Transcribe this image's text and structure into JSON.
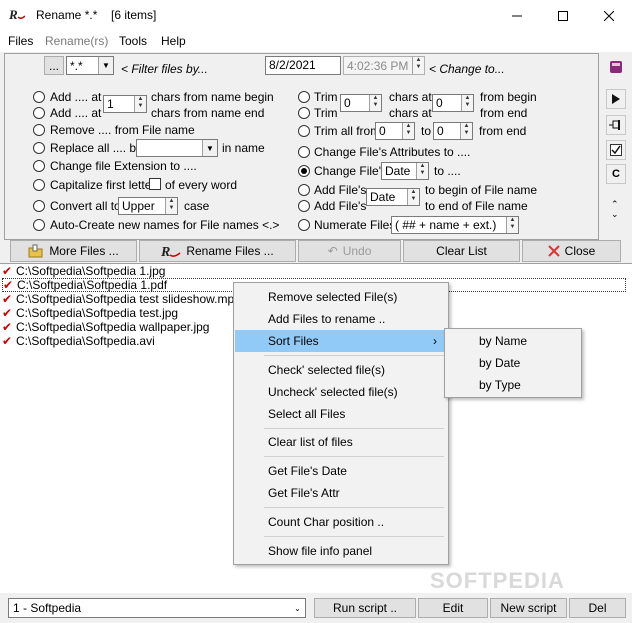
{
  "window": {
    "title": "Rename  *.*",
    "items": "[6 items]"
  },
  "menubar": [
    "Files",
    "Rename(rs)",
    "Tools",
    "Help"
  ],
  "filter": {
    "browse_label": "...",
    "mask": "*.*",
    "filter_label": "< Filter files by...",
    "date": "8/2/2021",
    "time": "4:02:36 PM",
    "change_label": "< Change  to..."
  },
  "options_left": {
    "add_at_1": "Add .... at",
    "add_at_1_value": "1",
    "add_at_1_suffix": "chars from name begin",
    "add_at_2": "Add .... at",
    "add_at_2_suffix": "chars from name end",
    "remove": "Remove  ....  from File name",
    "replace": "Replace all .... by",
    "replace_suffix": "in name",
    "change_ext": "Change file Extension to ....",
    "capitalize": "Capitalize first letter",
    "every_word": "of every word",
    "convert": "Convert all to",
    "convert_value": "Upper",
    "convert_suffix": "case",
    "auto_create": "Auto-Create new names for File names <.>"
  },
  "options_right": {
    "trim1": "Trim",
    "trim1_value": "0",
    "trim1_mid": "chars at",
    "trim1_value2": "0",
    "trim1_suffix": "from begin",
    "trim2": "Trim",
    "trim2_mid": "chars at",
    "trim2_suffix": "from  end",
    "trim_all": "Trim all from",
    "trim_all_value": "0",
    "trim_all_to": "to",
    "trim_all_value2": "0",
    "trim_all_suffix": "from end",
    "change_attr": "Change File's Attributes to ....",
    "change_file": "Change File's",
    "change_file_value": "Date",
    "change_file_suffix": "to ....",
    "add_file_1": "Add File's",
    "add_file_value": "Date",
    "add_file_1_suffix": "to begin of File name",
    "add_file_2": "Add File's",
    "add_file_2_suffix": "to end of File name",
    "numerate": "Numerate Files",
    "numerate_value": "( ## + name + ext.)"
  },
  "toolbar": {
    "more_files": "More Files ...",
    "rename_files": "Rename Files ...",
    "undo": "Undo",
    "clear_list": "Clear List",
    "close": "Close"
  },
  "files": [
    "C:\\Softpedia\\Softpedia 1.jpg",
    "C:\\Softpedia\\Softpedia 1.pdf",
    "C:\\Softpedia\\Softpedia test slideshow.mp3",
    "C:\\Softpedia\\Softpedia test.jpg",
    "C:\\Softpedia\\Softpedia wallpaper.jpg",
    "C:\\Softpedia\\Softpedia.avi"
  ],
  "context_menu": {
    "remove_selected": "Remove selected File(s)",
    "add_files": "Add Files to rename ..",
    "sort_files": "Sort Files",
    "check_selected": "Check' selected file(s)",
    "uncheck_selected": "Uncheck' selected file(s)",
    "select_all": "Select all Files",
    "clear_list": "Clear list of files",
    "get_date": "Get File's Date",
    "get_attr": "Get File's Attr",
    "count_char": "Count Char position ..",
    "show_info": "Show file info panel"
  },
  "submenu": {
    "by_name": "by Name",
    "by_date": "by Date",
    "by_type": "by Type"
  },
  "bottom": {
    "script": "1 - Softpedia",
    "run_script": "Run script ..",
    "edit": "Edit",
    "new_script": "New script",
    "del": "Del"
  },
  "watermark": "SOFTPEDIA",
  "colors": {
    "highlight": "#91c9f7",
    "check_mark": "#d00000"
  }
}
